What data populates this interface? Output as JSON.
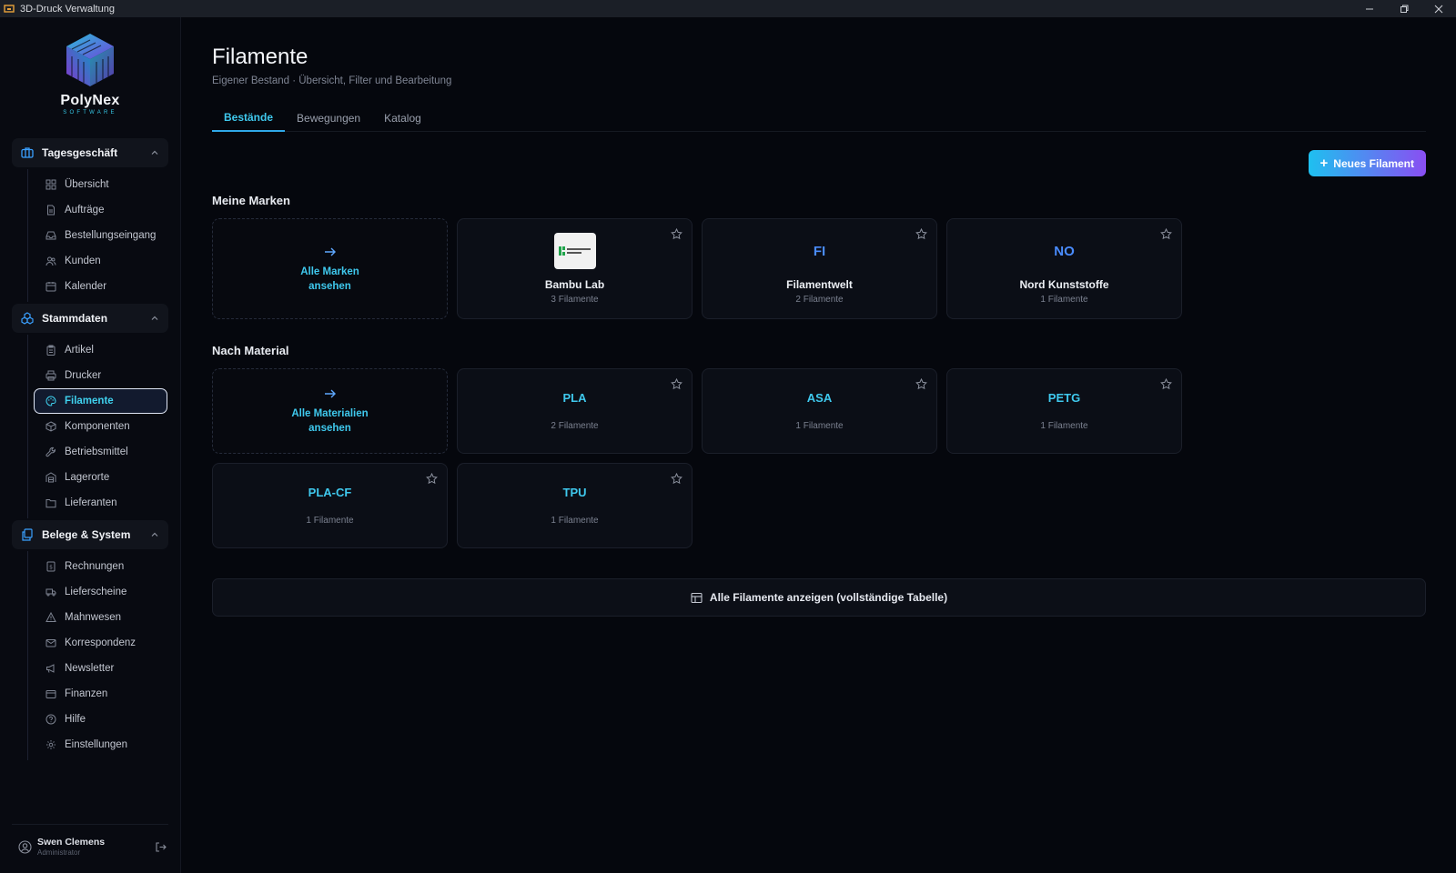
{
  "window": {
    "title": "3D-Druck Verwaltung"
  },
  "brand": {
    "name": "PolyNex",
    "sub": "SOFTWARE"
  },
  "sidebar": {
    "sections": [
      {
        "label": "Tagesgeschäft",
        "items": [
          "Übersicht",
          "Aufträge",
          "Bestellungseingang",
          "Kunden",
          "Kalender"
        ]
      },
      {
        "label": "Stammdaten",
        "items": [
          "Artikel",
          "Drucker",
          "Filamente",
          "Komponenten",
          "Betriebsmittel",
          "Lagerorte",
          "Lieferanten"
        ]
      },
      {
        "label": "Belege & System",
        "items": [
          "Rechnungen",
          "Lieferscheine",
          "Mahnwesen",
          "Korrespondenz",
          "Newsletter",
          "Finanzen",
          "Hilfe",
          "Einstellungen"
        ]
      }
    ],
    "active_item": "Filamente"
  },
  "user": {
    "name": "Swen Clemens",
    "role": "Administrator"
  },
  "page": {
    "title": "Filamente",
    "subtitle": "Eigener Bestand · Übersicht, Filter und Bearbeitung",
    "tabs": [
      "Bestände",
      "Bewegungen",
      "Katalog"
    ],
    "active_tab": "Bestände",
    "new_button": "Neues Filament"
  },
  "brands": {
    "title": "Meine Marken",
    "all_label_1": "Alle Marken",
    "all_label_2": "ansehen",
    "cards": [
      {
        "name": "Bambu Lab",
        "count": "3 Filamente",
        "logo": "bambu-lab-logo"
      },
      {
        "name": "Filamentwelt",
        "count": "2 Filamente",
        "initials": "FI"
      },
      {
        "name": "Nord Kunststoffe",
        "count": "1 Filamente",
        "initials": "NO"
      }
    ]
  },
  "materials": {
    "title": "Nach Material",
    "all_label_1": "Alle Materialien",
    "all_label_2": "ansehen",
    "cards": [
      {
        "name": "PLA",
        "count": "2 Filamente"
      },
      {
        "name": "ASA",
        "count": "1 Filamente"
      },
      {
        "name": "PETG",
        "count": "1 Filamente"
      },
      {
        "name": "PLA-CF",
        "count": "1 Filamente"
      },
      {
        "name": "TPU",
        "count": "1 Filamente"
      }
    ]
  },
  "full_table_label": "Alle Filamente anzeigen (vollständige Tabelle)",
  "colors": {
    "accent": "#3fc9ee",
    "initials": "#4a8cff",
    "gradient_start": "#1ec0f0",
    "gradient_end": "#8a4ef2"
  }
}
